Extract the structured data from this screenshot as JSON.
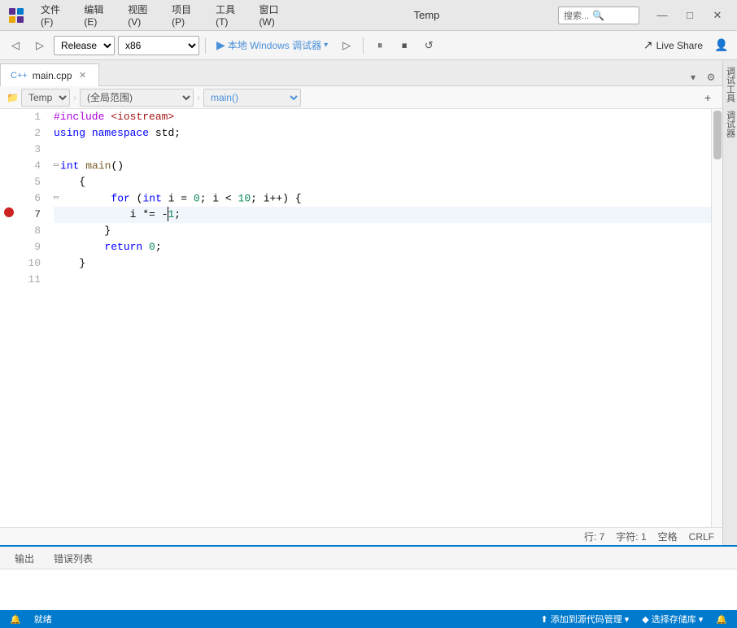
{
  "titleBar": {
    "title": "Temp",
    "menus": [
      {
        "label": "文件(F)"
      },
      {
        "label": "编辑(E)"
      },
      {
        "label": "视图(V)"
      },
      {
        "label": "项目(P)"
      },
      {
        "label": "工具(T)"
      },
      {
        "label": "窗口(W)"
      }
    ],
    "searchPlaceholder": "搜索...",
    "controls": {
      "minimize": "—",
      "maximize": "□",
      "close": "✕"
    }
  },
  "toolbar": {
    "releaseConfig": "Release",
    "platformConfig": "x86",
    "debugTarget": "本地 Windows 调试器",
    "liveShare": "Live Share"
  },
  "tabs": [
    {
      "label": "main.cpp",
      "active": true
    }
  ],
  "navBar": {
    "project": "Temp",
    "scope": "(全局范围)",
    "symbol": "main()"
  },
  "code": {
    "lines": [
      {
        "num": 1,
        "tokens": [
          {
            "t": "#include <iostream>",
            "c": "pp"
          }
        ]
      },
      {
        "num": 2,
        "tokens": [
          {
            "t": "using namespace std;",
            "c": "plain"
          }
        ]
      },
      {
        "num": 3,
        "tokens": []
      },
      {
        "num": 4,
        "tokens": [
          {
            "t": "int main()",
            "c": "plain"
          }
        ],
        "hasFold": true
      },
      {
        "num": 5,
        "tokens": [
          {
            "t": "{",
            "c": "plain"
          }
        ]
      },
      {
        "num": 6,
        "tokens": [
          {
            "t": "    for (int i = 0; i < 10; i++) {",
            "c": "plain"
          }
        ],
        "hasFold": true
      },
      {
        "num": 7,
        "tokens": [
          {
            "t": "        i *= -1;",
            "c": "plain"
          }
        ],
        "current": true
      },
      {
        "num": 8,
        "tokens": [
          {
            "t": "    }",
            "c": "plain"
          }
        ]
      },
      {
        "num": 9,
        "tokens": [
          {
            "t": "    return 0;",
            "c": "plain"
          }
        ]
      },
      {
        "num": 10,
        "tokens": [
          {
            "t": "}",
            "c": "plain"
          }
        ]
      },
      {
        "num": 11,
        "tokens": []
      }
    ]
  },
  "statusBar": {
    "ready": "就绪",
    "addToSource": "添加到源代码管理",
    "selectRepo": "选择存储库",
    "lineInfo": "行: 7",
    "charInfo": "字符: 1",
    "spaceInfo": "空格",
    "encodingInfo": "CRLF"
  },
  "bottomTabs": [
    {
      "label": "输出"
    },
    {
      "label": "错误列表"
    }
  ]
}
